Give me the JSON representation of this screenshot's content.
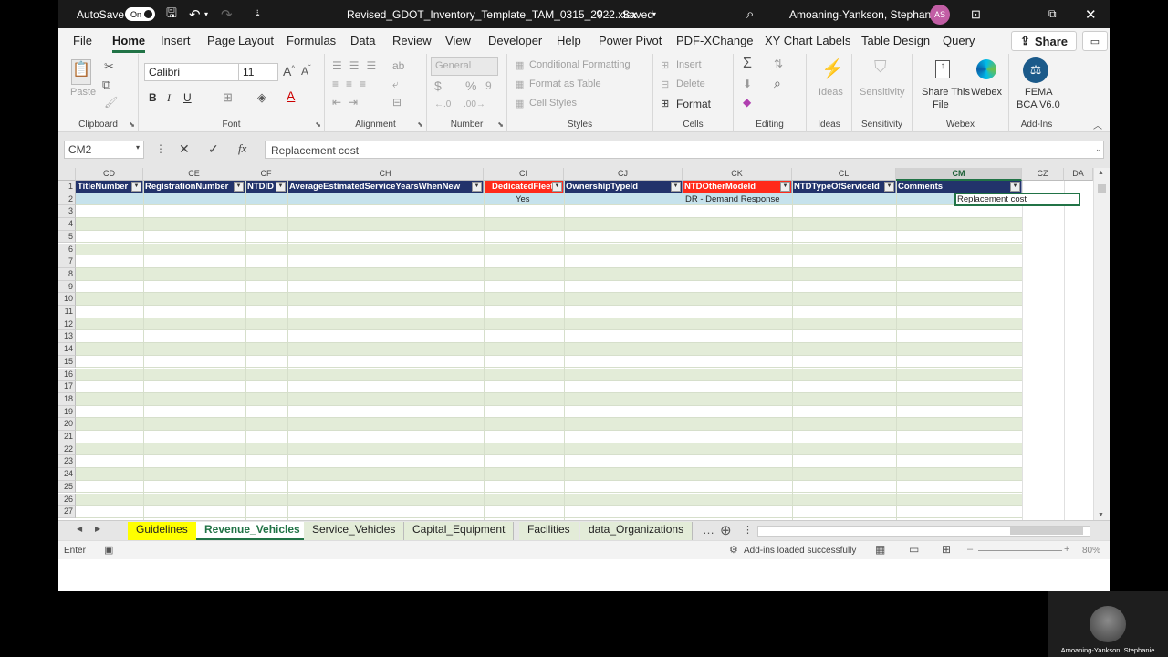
{
  "titlebar": {
    "autosave_label": "AutoSave",
    "autosave_state": "On",
    "filename": "Revised_GDOT_Inventory_Template_TAM_0315_2022.xlsx",
    "save_status": "Saved",
    "user_name": "Amoaning-Yankson, Stephanie",
    "user_initials": "AS"
  },
  "menu": {
    "tabs": [
      "File",
      "Home",
      "Insert",
      "Page Layout",
      "Formulas",
      "Data",
      "Review",
      "View",
      "Developer",
      "Help",
      "Power Pivot",
      "PDF-XChange",
      "XY Chart Labels",
      "Table Design",
      "Query"
    ],
    "active": "Home",
    "share_label": "Share"
  },
  "ribbon": {
    "clipboard": {
      "paste": "Paste",
      "label": "Clipboard"
    },
    "font": {
      "name": "Calibri",
      "size": "11",
      "bold": "B",
      "italic": "I",
      "underline": "U",
      "label": "Font"
    },
    "alignment": {
      "label": "Alignment"
    },
    "number": {
      "format": "General",
      "currency": "$",
      "percent": "%",
      "label": "Number"
    },
    "styles": {
      "conditional": "Conditional Formatting",
      "format_table": "Format as Table",
      "cell_styles": "Cell Styles",
      "label": "Styles"
    },
    "cells": {
      "insert": "Insert",
      "delete": "Delete",
      "format": "Format",
      "label": "Cells"
    },
    "editing": {
      "label": "Editing"
    },
    "ideas": {
      "button": "Ideas",
      "label": "Ideas"
    },
    "sensitivity": {
      "button": "Sensitivity",
      "label": "Sensitivity"
    },
    "webex": {
      "share_line1": "Share This",
      "share_line2": "File",
      "webex": "Webex",
      "label": "Webex"
    },
    "addins": {
      "fema_line1": "FEMA",
      "fema_line2": "BCA V6.0",
      "label": "Add-Ins"
    }
  },
  "formula_bar": {
    "name_box": "CM2",
    "content": "Replacement cost"
  },
  "sheet": {
    "columns": [
      "CD",
      "CE",
      "CF",
      "CH",
      "CI",
      "CJ",
      "CK",
      "CL",
      "CM",
      "CZ",
      "DA"
    ],
    "selected_column": "CM",
    "headers": [
      "TitleNumber",
      "RegistrationNumber",
      "NTDID",
      "AverageEstimatedServiceYearsWhenNew",
      "DedicatedFleet",
      "OwnershipTypeId",
      "NTDOtherModeId",
      "NTDTypeOfServiceId",
      "Comments"
    ],
    "row2": {
      "dedicated_fleet": "Yes",
      "ntd_other_mode": "DR - Demand Response",
      "comments": "Replacement cost"
    },
    "row_numbers": [
      "1",
      "2",
      "3",
      "4",
      "5",
      "6",
      "7",
      "8",
      "9",
      "10",
      "11",
      "12",
      "13",
      "14",
      "15",
      "16",
      "17",
      "18",
      "19",
      "20",
      "21",
      "22",
      "23",
      "24",
      "25",
      "26",
      "27"
    ]
  },
  "sheet_tabs": [
    "Guidelines",
    "Revenue_Vehicles",
    "Service_Vehicles",
    "Capital_Equipment",
    "Facilities",
    "data_Organizations"
  ],
  "active_sheet": "Revenue_Vehicles",
  "status": {
    "mode": "Enter",
    "addins_msg": "Add-ins loaded successfully",
    "zoom": "80%"
  },
  "video": {
    "participant": "Amoaning-Yankson, Stephanie"
  }
}
